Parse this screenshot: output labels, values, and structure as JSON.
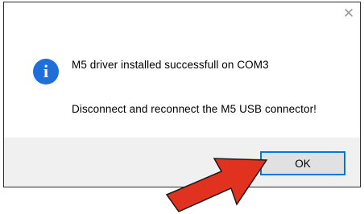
{
  "dialog": {
    "close_glyph": "✕",
    "icon": "info-icon",
    "icon_glyph": "i",
    "message_line_1": "M5 driver installed successfull on COM3",
    "message_line_2": "Disconnect and reconnect the M5 USB connector!",
    "ok_label": "OK"
  },
  "colors": {
    "info_icon": "#1e6fd9",
    "button_focus_border": "#0078d7",
    "footer_bg": "#f0f0f0",
    "arrow_fill": "#e0321e"
  }
}
